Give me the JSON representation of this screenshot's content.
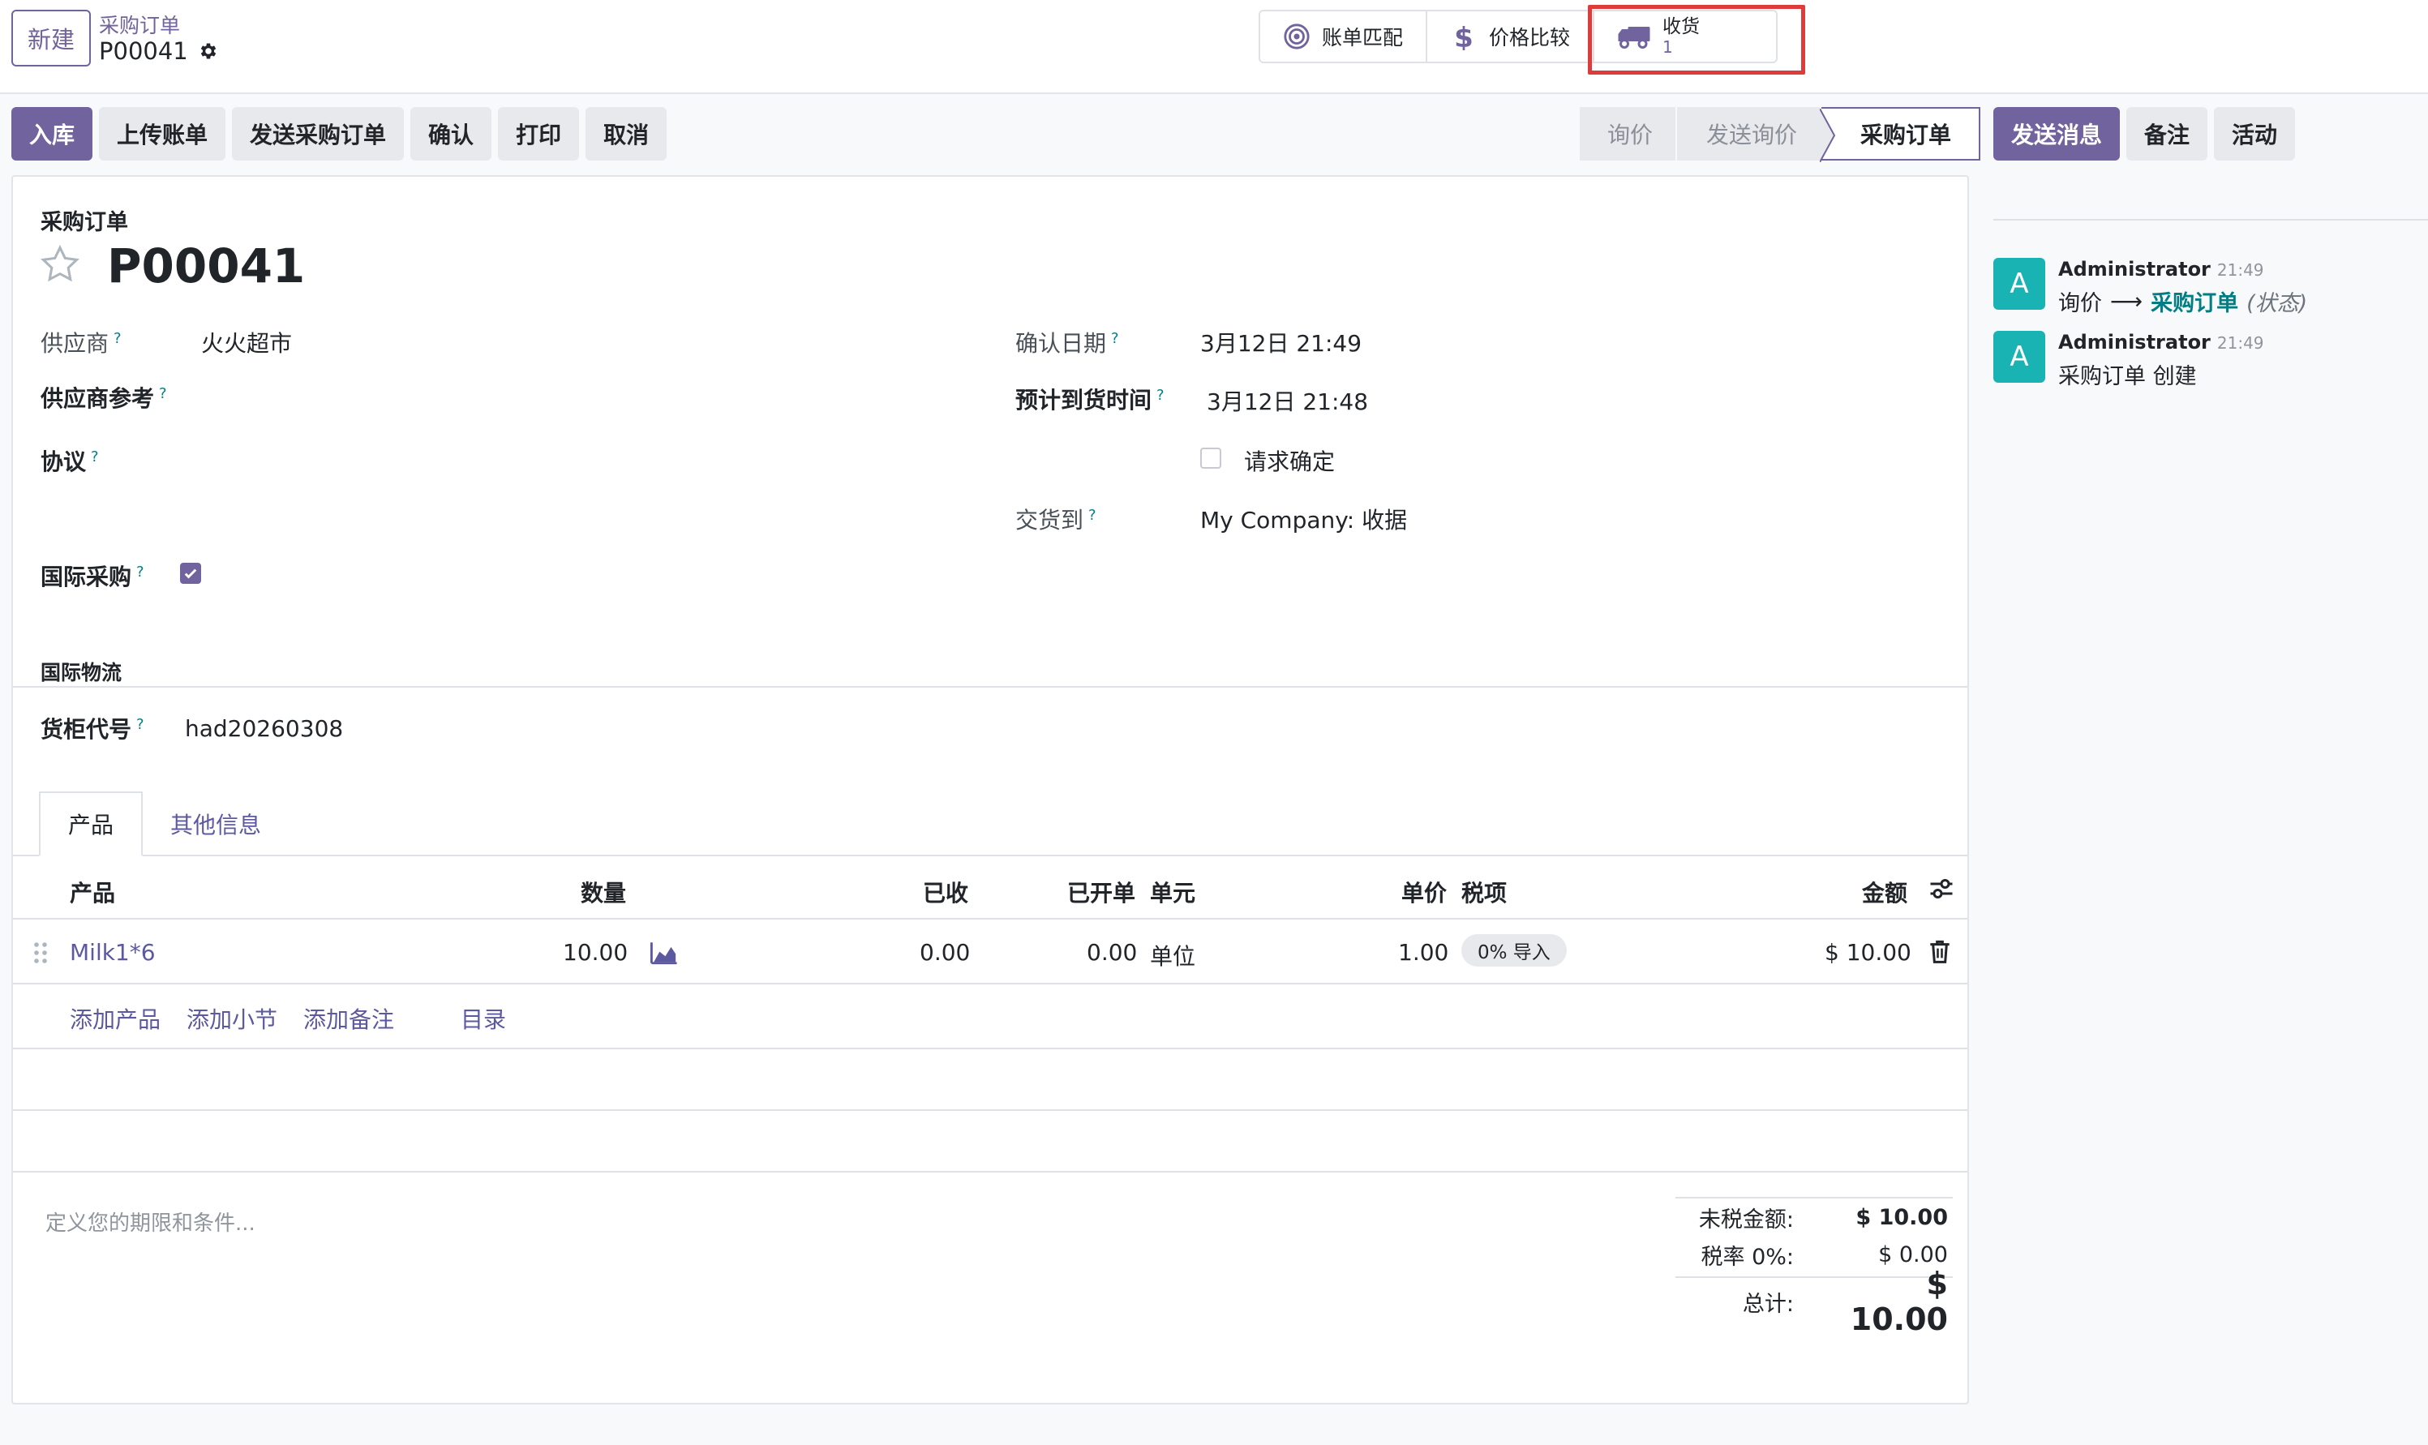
{
  "breadcrumb": {
    "new_label": "新建",
    "parent": "采购订单",
    "current": "P00041"
  },
  "smart_buttons": {
    "bill_match": "账单匹配",
    "price_compare": "价格比较",
    "receipt_label": "收货",
    "receipt_count": "1"
  },
  "actions": [
    "入库",
    "上传账单",
    "发送采购订单",
    "确认",
    "打印",
    "取消"
  ],
  "status": {
    "stages": [
      "询价",
      "发送询价",
      "采购订单"
    ],
    "active": "采购订单"
  },
  "chatter_actions": {
    "send": "发送消息",
    "note": "备注",
    "activity": "活动"
  },
  "form": {
    "title_label": "采购订单",
    "name": "P00041",
    "vendor_label": "供应商",
    "vendor": "火火超市",
    "vendor_ref_label": "供应商参考",
    "agreement_label": "协议",
    "international_label": "国际采购",
    "confirm_date_label": "确认日期",
    "confirm_date": "3月12日 21:49",
    "expected_arrival_label": "预计到货时间",
    "expected_arrival": "3月12日 21:48",
    "ask_confirm_label": "请求确定",
    "deliver_to_label": "交货到",
    "deliver_to": "My Company: 收据",
    "section_logistics": "国际物流",
    "container_label": "货柜代号",
    "container": "had20260308",
    "help_mark": "?"
  },
  "tabs": [
    "产品",
    "其他信息"
  ],
  "table": {
    "headers": {
      "product": "产品",
      "qty": "数量",
      "received": "已收",
      "billed": "已开单",
      "uom": "单元",
      "price": "单价",
      "tax": "税项",
      "amount": "金额"
    },
    "rows": [
      {
        "product": "Milk1*6",
        "qty": "10.00",
        "received": "0.00",
        "billed": "0.00",
        "uom": "单位",
        "price": "1.00",
        "tax": "0% 导入",
        "amount": "$ 10.00"
      }
    ],
    "add_links": {
      "product": "添加产品",
      "section": "添加小节",
      "note": "添加备注",
      "catalog": "目录"
    }
  },
  "terms_placeholder": "定义您的期限和条件...",
  "totals": {
    "untaxed_label": "未税金额:",
    "untaxed": "$ 10.00",
    "tax_label": "税率 0%:",
    "tax": "$ 0.00",
    "total_label": "总计:",
    "total": "$ 10.00"
  },
  "chatter": [
    {
      "avatar": "A",
      "author": "Administrator",
      "time": "21:49",
      "old": "询价",
      "arrow": "⟶",
      "new": "采购订单",
      "field": "(状态)"
    },
    {
      "avatar": "A",
      "author": "Administrator",
      "time": "21:49",
      "text": "采购订单 创建"
    }
  ],
  "colors": {
    "brand": "#71639e",
    "link": "#5c59a0",
    "teal": "#017e84",
    "avatar": "#1ab3b3",
    "highlight": "#e03b3b"
  },
  "icons": [
    "gear-icon",
    "target-icon",
    "dollar-icon",
    "truck-icon",
    "star-icon",
    "check-icon",
    "chart-icon",
    "trash-icon",
    "drag-handle-icon",
    "settings-sliders-icon"
  ]
}
